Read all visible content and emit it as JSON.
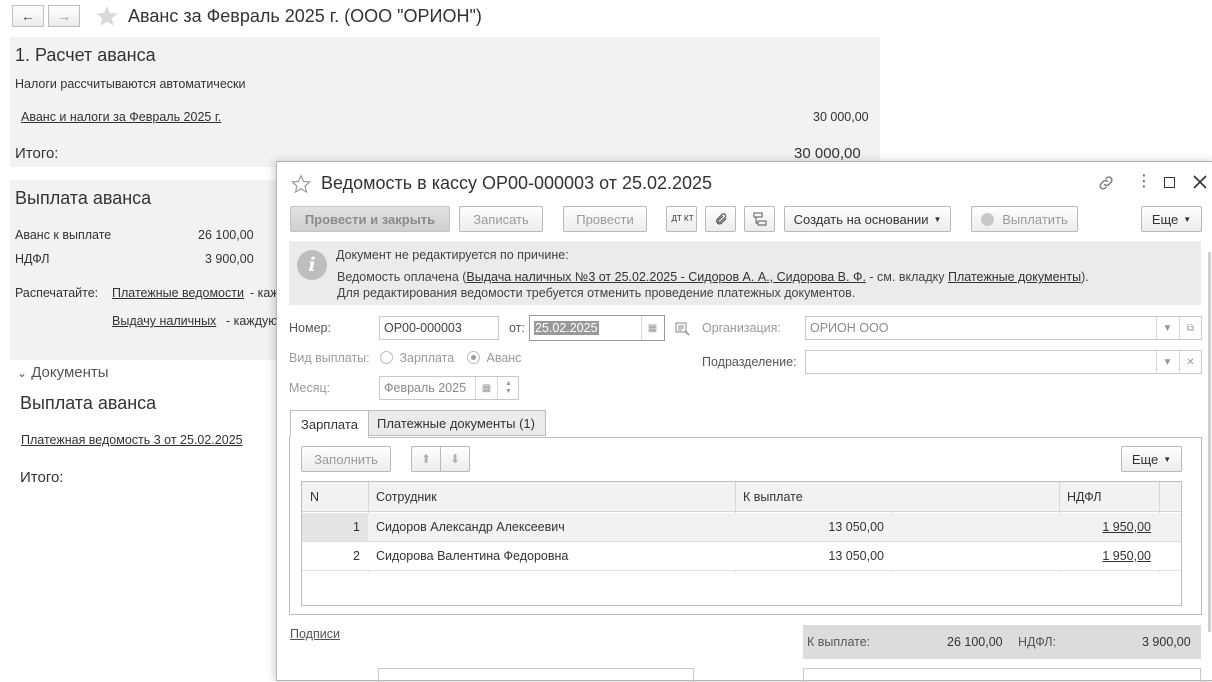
{
  "background": {
    "nav": {
      "back": "←",
      "forward": "→"
    },
    "title": "Аванс за Февраль 2025 г. (ООО \"ОРИОН\")",
    "section1": {
      "heading": "1. Расчет аванса",
      "note": "Налоги рассчитываются автоматически",
      "link": "Аванс и налоги за Февраль 2025 г.",
      "link_amount": "30 000,00",
      "total_label": "Итого:",
      "total_value": "30 000,00"
    },
    "section2": {
      "heading": "Выплата аванса",
      "advance_label": "Аванс к выплате",
      "advance_value": "26 100,00",
      "ndfl_label": "НДФЛ",
      "ndfl_value": "3 900,00",
      "print_label": "Распечатайте:",
      "print_link1": "Платежные ведомости",
      "print_suffix1": "- каж",
      "print_link2": "Выдачу наличных",
      "print_suffix2": "- каждую"
    },
    "docs": {
      "toggle": "Документы",
      "heading": "Выплата аванса",
      "link": "Платежная ведомость 3 от 25.02.2025",
      "total_label": "Итого:"
    }
  },
  "modal": {
    "title": "Ведомость в кассу ОР00-000003 от 25.02.2025",
    "toolbar": {
      "post_close": "Провести и закрыть",
      "save": "Записать",
      "post": "Провести",
      "dtkt": "ДТ КТ",
      "create_based": "Создать на основании",
      "pay": "Выплатить",
      "more": "Еще"
    },
    "info": {
      "line1": "Документ не редактируется по причине:",
      "line2_prefix": "Ведомость оплачена (",
      "line2_link": "Выдача наличных №3 от 25.02.2025 - Сидоров А. А., Сидорова В. Ф.",
      "line2_mid": " - см. вкладку ",
      "line2_link2": "Платежные документы",
      "line2_suffix": ").",
      "line3": "Для редактирования ведомости требуется отменить проведение платежных документов."
    },
    "form": {
      "number_label": "Номер:",
      "number_value": "ОР00-000003",
      "date_label": "от:",
      "date_value": "25.02.2025",
      "org_label": "Организация:",
      "org_value": "ОРИОН ООО",
      "dept_label": "Подразделение:",
      "dept_value": "",
      "paytype_label": "Вид выплаты:",
      "paytype_salary": "Зарплата",
      "paytype_advance": "Аванс",
      "month_label": "Месяц:",
      "month_value": "Февраль 2025"
    },
    "tabs": {
      "salary": "Зарплата",
      "paydocs": "Платежные документы (1)"
    },
    "grid_toolbar": {
      "fill": "Заполнить",
      "more": "Еще"
    },
    "table": {
      "headers": {
        "n": "N",
        "employee": "Сотрудник",
        "to_pay": "К выплате",
        "ndfl": "НДФЛ"
      },
      "rows": [
        {
          "n": "1",
          "employee": "Сидоров Александр Алексеевич",
          "to_pay": "13 050,00",
          "ndfl": "1 950,00"
        },
        {
          "n": "2",
          "employee": "Сидорова Валентина Федоровна",
          "to_pay": "13 050,00",
          "ndfl": "1 950,00"
        }
      ]
    },
    "footer": {
      "signatures": "Подписи",
      "to_pay_label": "К выплате:",
      "to_pay_value": "26 100,00",
      "ndfl_label": "НДФЛ:",
      "ndfl_value": "3 900,00"
    }
  }
}
